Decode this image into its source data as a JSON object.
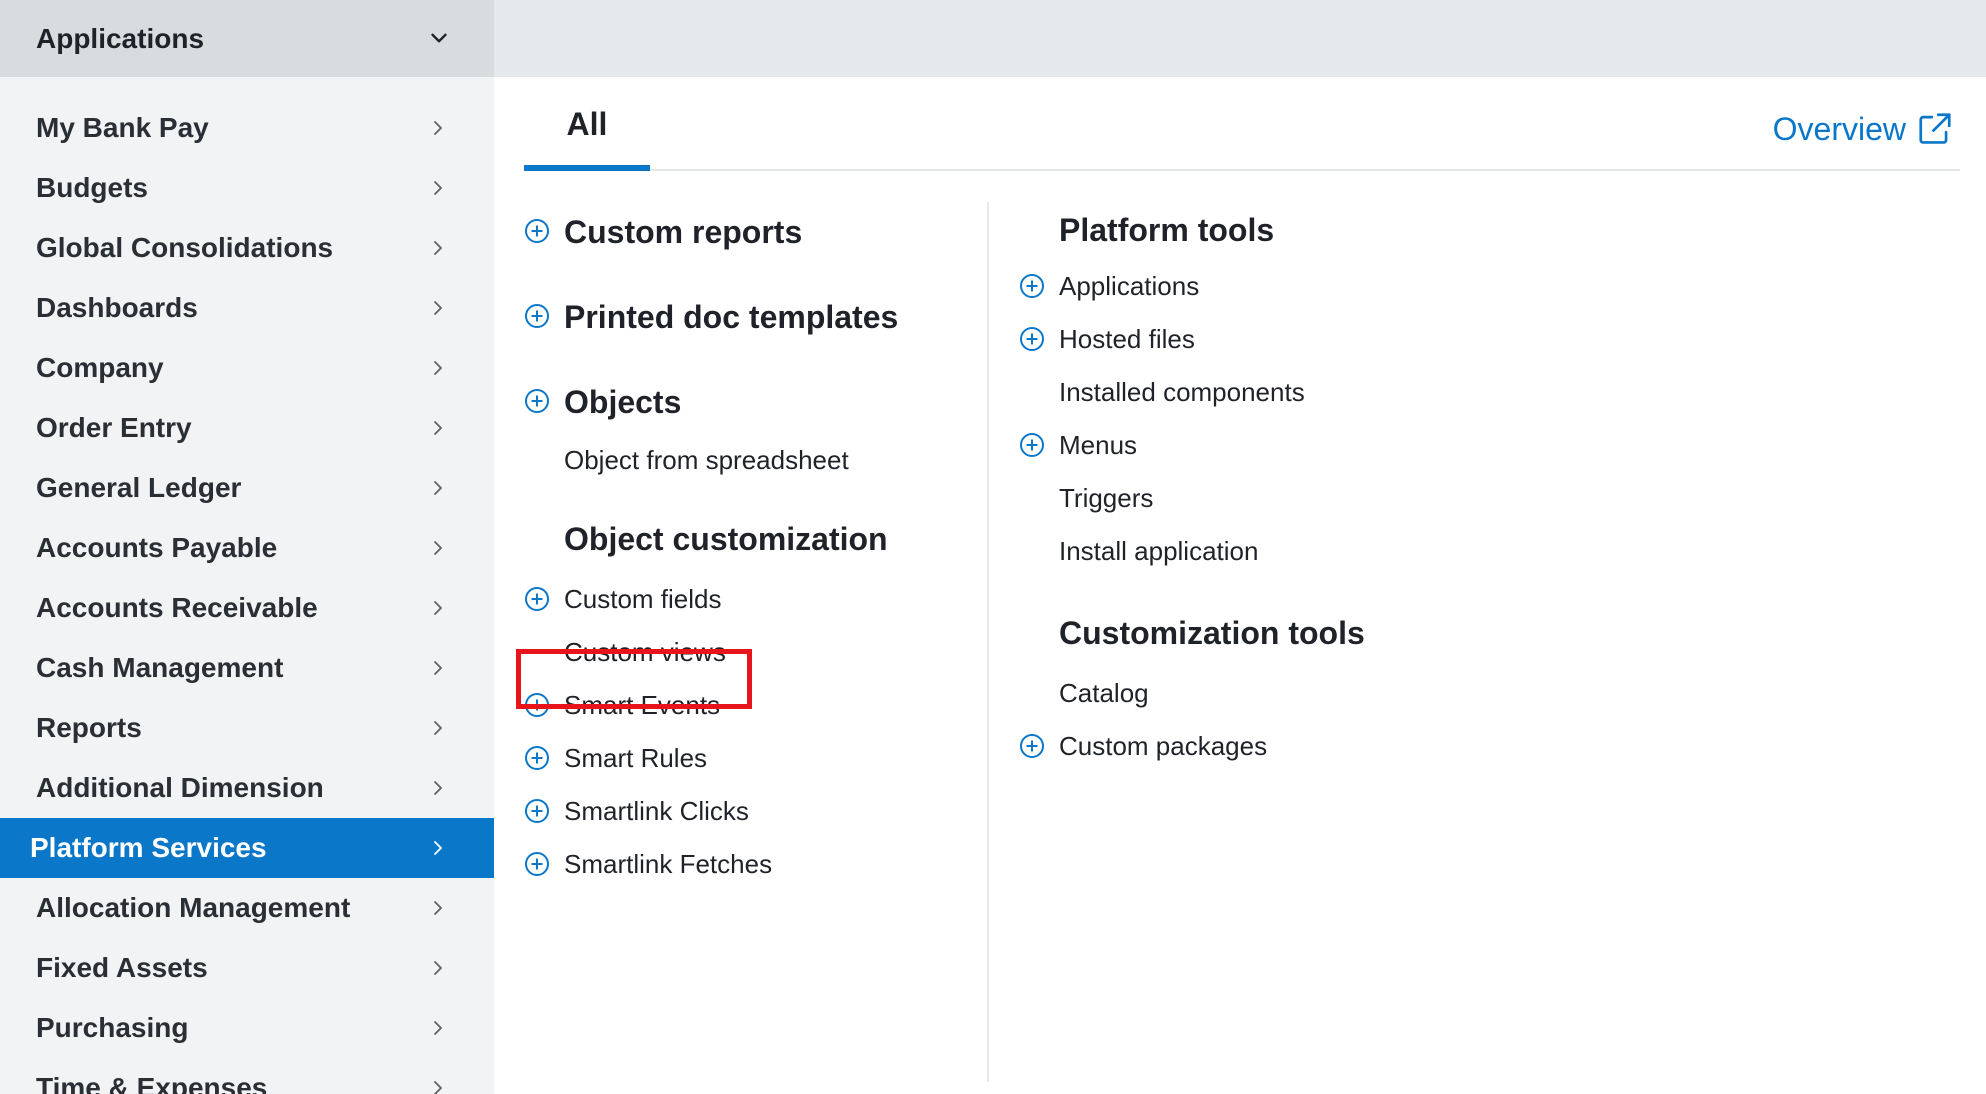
{
  "header": {
    "app_label": "Applications",
    "chevron_icon": "chevron-down-icon"
  },
  "sidebar": {
    "items": [
      {
        "label": "My Bank Pay"
      },
      {
        "label": "Budgets"
      },
      {
        "label": "Global Consolidations"
      },
      {
        "label": "Dashboards"
      },
      {
        "label": "Company"
      },
      {
        "label": "Order Entry"
      },
      {
        "label": "General Ledger"
      },
      {
        "label": "Accounts Payable"
      },
      {
        "label": "Accounts Receivable"
      },
      {
        "label": "Cash Management"
      },
      {
        "label": "Reports"
      },
      {
        "label": "Additional Dimension"
      },
      {
        "label": "Platform Services",
        "active": true
      },
      {
        "label": "Allocation Management"
      },
      {
        "label": "Fixed Assets"
      },
      {
        "label": "Purchasing"
      },
      {
        "label": "Time & Expenses"
      }
    ]
  },
  "tabs": {
    "all_label": "All",
    "overview_label": "Overview",
    "overview_icon": "external-link-icon"
  },
  "left_column": {
    "custom_reports": "Custom reports",
    "printed_doc_templates": "Printed doc templates",
    "objects": "Objects",
    "object_from_spreadsheet": "Object from spreadsheet",
    "object_customization_heading": "Object customization",
    "custom_fields": "Custom fields",
    "custom_views": "Custom views",
    "smart_events": "Smart Events",
    "smart_rules": "Smart Rules",
    "smartlink_clicks": "Smartlink Clicks",
    "smartlink_fetches": "Smartlink Fetches"
  },
  "right_column": {
    "platform_tools_heading": "Platform tools",
    "applications": "Applications",
    "hosted_files": "Hosted files",
    "installed_components": "Installed components",
    "menus": "Menus",
    "triggers": "Triggers",
    "install_application": "Install application",
    "customization_tools_heading": "Customization tools",
    "catalog": "Catalog",
    "custom_packages": "Custom packages"
  },
  "colors": {
    "accent": "#0a77c8",
    "highlight": "#e8141b",
    "sidebar_bg": "#f2f3f4",
    "topbar_bg": "#e6e9ec"
  }
}
